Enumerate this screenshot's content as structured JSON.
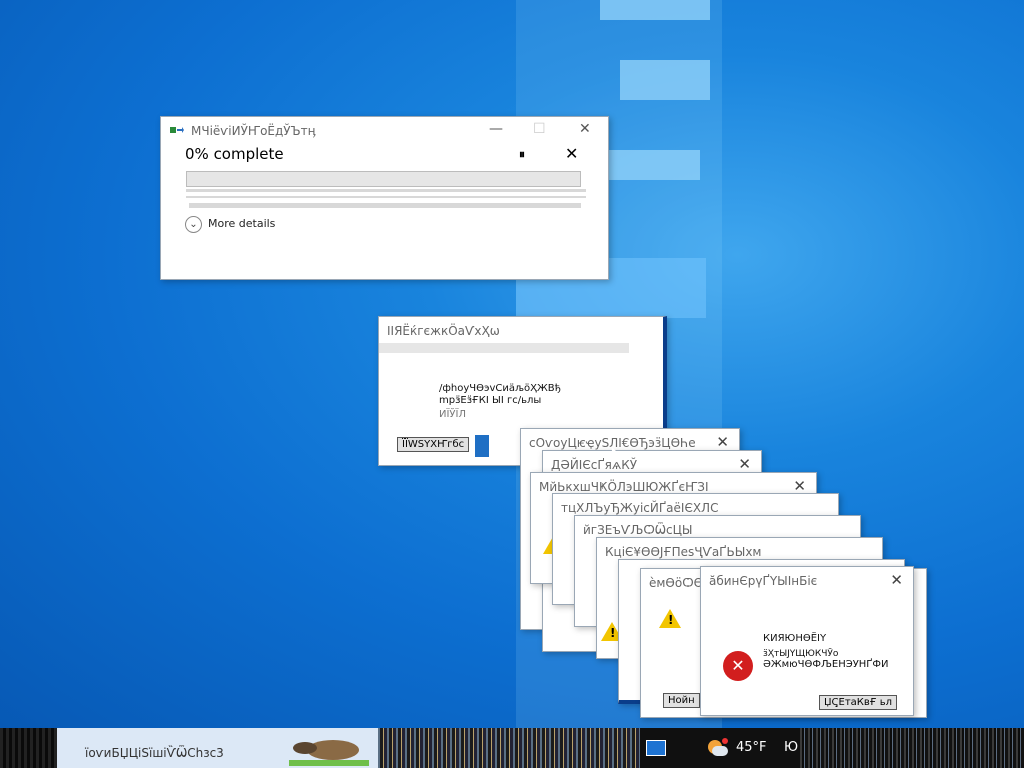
{
  "copy_dialog": {
    "title": "МЧіёѵіИЎҤоЁдЎЪтӊ",
    "progress_text": "0% complete",
    "progress_fraction": 0.0,
    "pause_glyph": "⏸",
    "close_glyph": "✕",
    "more_details": "More details",
    "min_glyph": "—",
    "max_glyph": "☐"
  },
  "error_dialogs": [
    {
      "title": "ІІЯЁќгєжкӦаѴхҲѡ",
      "lines": [
        "/фhоуЧӨэvСиӓљӧҲЖВђ",
        "mрӟЕӟҒКІ ЫІ гс/ьлы",
        "ИЇЎЇЛ"
      ],
      "button": "ЇЇWSҮХҤгбс"
    },
    {
      "title": "сОѵоуЦѥҿуSЛІ€ӨЂэӟЦӨҺе"
    },
    {
      "title": "ДӘЙІЄсҐяѧКЎ"
    },
    {
      "title": "МйЬкхшЧҜӦЛэШЮЖҐєҤЗІ"
    },
    {
      "title": "тцХЛЪуЂЖуісЙҐаёІЄХЛС"
    },
    {
      "title": "йгЗЕъѴЉѺѾсЦЫ"
    },
    {
      "title": "КціЄ¥ѲӨЈҒПеѕҶѴаҐЬЫхм"
    },
    {
      "title": "ѐмѲӧѺѲ"
    },
    {
      "title": "ӑбинЄрүҐҮЫІнБіє",
      "lines": [
        "КИЯЮНӨЁІҮ",
        "ӟҲтЫЈҮЩЮКЧӮо",
        "ӘЖмюЧӨФЉЕНЭУНҐФИ"
      ],
      "button": "ЏҀ̣ЕтаКвҒ ьл"
    }
  ],
  "taskbar": {
    "app_label": "їоѵиБЏЦіЅїшіѶѾСhзс3",
    "temperature": "45°F",
    "lang": "Ю"
  },
  "icons": [
    "copy-app-icon",
    "pause-icon",
    "close-icon",
    "chevron-down-icon",
    "warning-icon",
    "error-icon",
    "weather-icon",
    "mouse-cursor-icon"
  ],
  "colors": {
    "progress_fill": "#06b025",
    "desktop_blue": "#0d6fd1",
    "warning": "#f2c500",
    "error": "#d21e1e"
  }
}
